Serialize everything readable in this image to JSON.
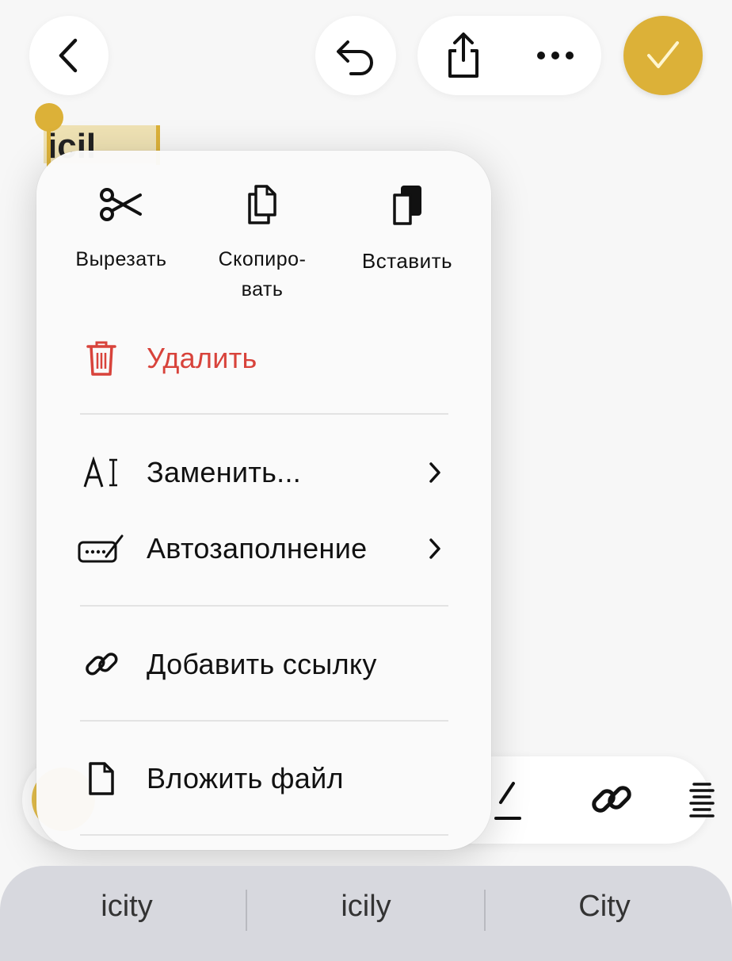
{
  "header": {
    "back_icon": "chevron-left-icon",
    "undo_icon": "undo-icon",
    "share_icon": "share-icon",
    "more_icon": "more-horizontal-icon",
    "done_icon": "checkmark-icon",
    "accent": "#dcb138"
  },
  "note": {
    "selected_text": "icil"
  },
  "context_menu": {
    "quick_actions": [
      {
        "label": "Вырезать",
        "icon": "scissors-icon"
      },
      {
        "label": "Скопиро-\nвать",
        "icon": "copy-icon"
      },
      {
        "label": "Вставить",
        "icon": "paste-icon"
      }
    ],
    "items": [
      {
        "label": "Удалить",
        "icon": "trash-icon",
        "destructive": true
      },
      {
        "label": "Заменить...",
        "icon": "replace-text-icon",
        "has_submenu": true
      },
      {
        "label": "Автозаполнение",
        "icon": "autofill-icon",
        "has_submenu": true
      },
      {
        "label": "Добавить ссылку",
        "icon": "link-icon"
      },
      {
        "label": "Вложить файл",
        "icon": "document-icon"
      }
    ],
    "destructive_color": "#d8433b"
  },
  "format_toolbar": {
    "icons": [
      "pen-icon",
      "link-icon",
      "list-icon"
    ]
  },
  "keyboard_suggestions": [
    "icity",
    "icily",
    "City"
  ]
}
